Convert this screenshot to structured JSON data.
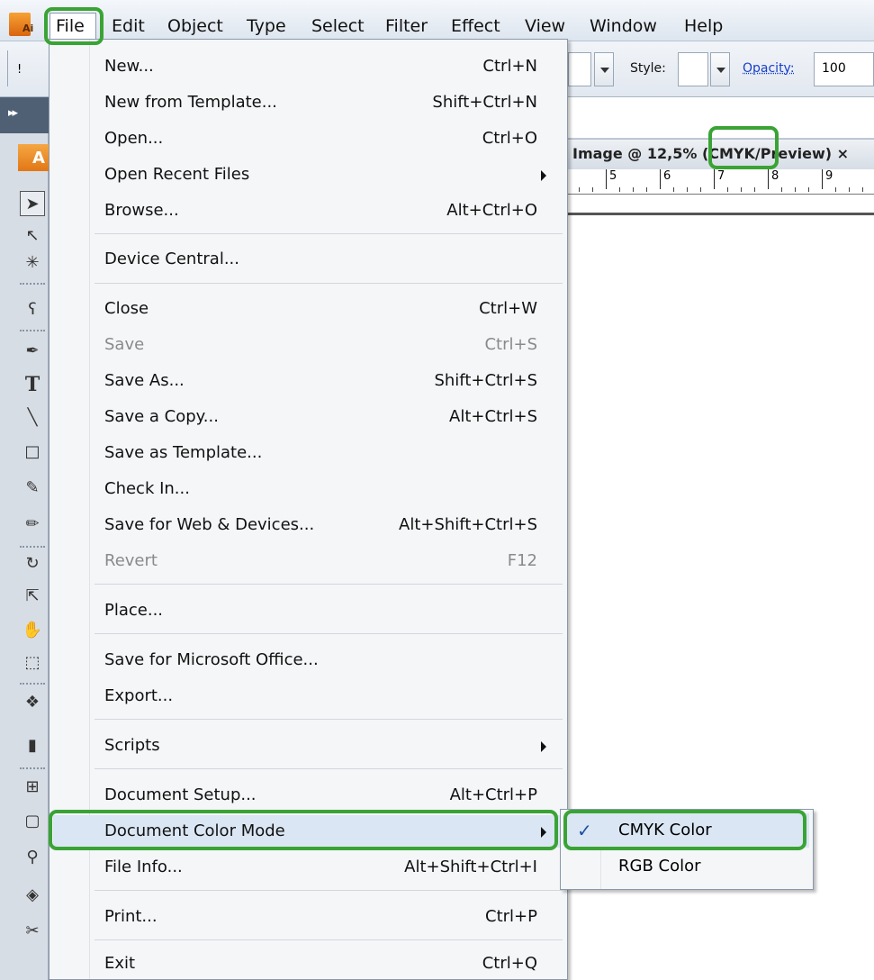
{
  "menubar": {
    "items": [
      "File",
      "Edit",
      "Object",
      "Type",
      "Select",
      "Filter",
      "Effect",
      "View",
      "Window",
      "Help"
    ],
    "app_icon": "Ai"
  },
  "control_bar": {
    "style_label": "Style:",
    "opacity_label": "Opacity:",
    "opacity_value": "100"
  },
  "toolbar": {
    "collapse_glyph": "▸▸",
    "logo_letter": "A"
  },
  "document": {
    "tab_title": "Image @ 12,5% (CMYK/Preview) ×",
    "ruler_labels": [
      "5",
      "6",
      "7",
      "8",
      "9"
    ]
  },
  "file_menu": {
    "items": [
      {
        "label": "New...",
        "shortcut": "Ctrl+N"
      },
      {
        "label": "New from Template...",
        "shortcut": "Shift+Ctrl+N"
      },
      {
        "label": "Open...",
        "shortcut": "Ctrl+O"
      },
      {
        "label": "Open Recent Files",
        "shortcut": ""
      },
      {
        "label": "Browse...",
        "shortcut": "Alt+Ctrl+O"
      },
      {
        "label": "Device Central...",
        "shortcut": ""
      },
      {
        "label": "Close",
        "shortcut": "Ctrl+W"
      },
      {
        "label": "Save",
        "shortcut": "Ctrl+S"
      },
      {
        "label": "Save As...",
        "shortcut": "Shift+Ctrl+S"
      },
      {
        "label": "Save a Copy...",
        "shortcut": "Alt+Ctrl+S"
      },
      {
        "label": "Save as Template...",
        "shortcut": ""
      },
      {
        "label": "Check In...",
        "shortcut": ""
      },
      {
        "label": "Save for Web & Devices...",
        "shortcut": "Alt+Shift+Ctrl+S"
      },
      {
        "label": "Revert",
        "shortcut": "F12"
      },
      {
        "label": "Place...",
        "shortcut": ""
      },
      {
        "label": "Save for Microsoft Office...",
        "shortcut": ""
      },
      {
        "label": "Export...",
        "shortcut": ""
      },
      {
        "label": "Scripts",
        "shortcut": ""
      },
      {
        "label": "Document Setup...",
        "shortcut": "Alt+Ctrl+P"
      },
      {
        "label": "Document Color Mode",
        "shortcut": ""
      },
      {
        "label": "File Info...",
        "shortcut": "Alt+Shift+Ctrl+I"
      },
      {
        "label": "Print...",
        "shortcut": "Ctrl+P"
      },
      {
        "label": "Exit",
        "shortcut": "Ctrl+Q"
      }
    ]
  },
  "color_mode_submenu": {
    "items": [
      {
        "label": "CMYK Color",
        "checked": true,
        "check": "✓"
      },
      {
        "label": "RGB Color",
        "checked": false
      }
    ]
  },
  "colors": {
    "highlight_outline": "#3aa335",
    "menu_background": "#f4f6f8",
    "menu_hover": "#dbe6f4",
    "disabled_text": "#8a8a8a"
  }
}
